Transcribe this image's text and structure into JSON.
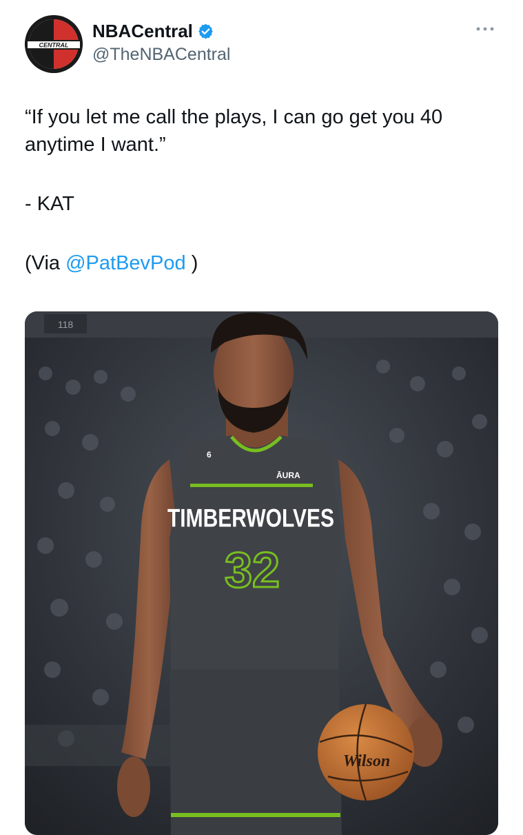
{
  "author": {
    "display_name": "NBACentral",
    "handle": "@TheNBACentral",
    "verified": true,
    "avatar_text": "CENTRAL"
  },
  "tweet": {
    "line1": "“If you let me call the plays, I can go get you 40 anytime I want.”",
    "line2": "- KAT",
    "via_prefix": "(Via ",
    "via_mention": "@PatBevPod",
    "via_suffix": " )"
  },
  "media": {
    "jersey_team": "TIMBERWOLVES",
    "jersey_number": "32",
    "jersey_sponsor": "ĀURA",
    "jersey_patch": "6",
    "ball_brand": "Wilson",
    "arena_sign": "118"
  },
  "colors": {
    "accent_blue": "#1d9bf0",
    "handle_gray": "#536471",
    "jersey_green": "#78be20"
  }
}
